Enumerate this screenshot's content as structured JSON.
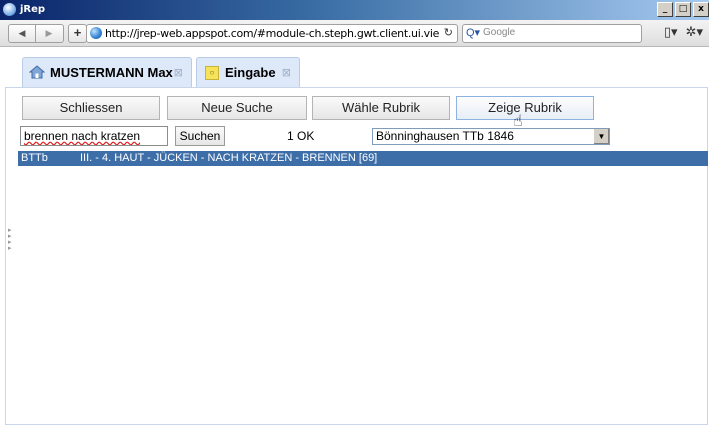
{
  "window": {
    "title": "jRep",
    "controls": [
      "_",
      "□",
      "x"
    ]
  },
  "browser": {
    "back_icon": "back-arrow-icon",
    "forward_icon": "forward-arrow-icon",
    "add_label": "+",
    "url": "http://jrep-web.appspot.com/#module-ch.steph.gwt.client.ui.vie",
    "reload": "C",
    "search_placeholder": "Google",
    "search_icon": "Q▾"
  },
  "tabs": [
    {
      "label": "MUSTERMANN Max",
      "icon": "home-icon",
      "close": "⊠"
    },
    {
      "label": "Eingabe",
      "icon": "document-icon",
      "close": "⊠"
    }
  ],
  "buttons": {
    "schliessen": "Schliessen",
    "neue_suche": "Neue Suche",
    "waehle_rubrik": "Wähle Rubrik",
    "zeige_rubrik": "Zeige Rubrik"
  },
  "search": {
    "value": "brennen nach kratzen",
    "submit_label": "Suchen",
    "status": "1 OK"
  },
  "source_select": {
    "selected": "Bönninghausen TTb 1846"
  },
  "results": [
    {
      "code": "BTTb",
      "rubrik": "III. - 4. HAUT - JÜCKEN - NACH KRATZEN - BRENNEN  [69]"
    }
  ],
  "colors": {
    "accent": "#3d6ea8",
    "tab_bg": "#dde9f8"
  }
}
